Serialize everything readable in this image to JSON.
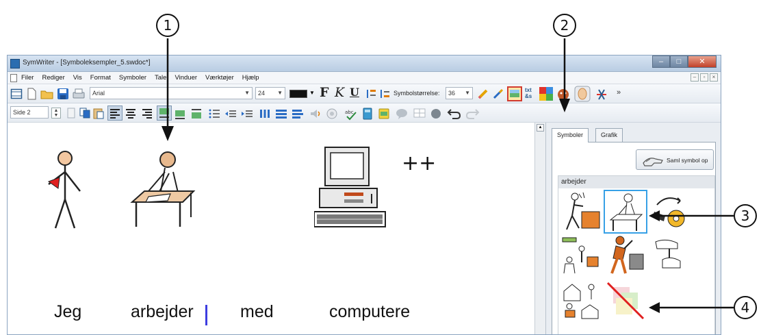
{
  "callouts": [
    "1",
    "2",
    "3",
    "4"
  ],
  "window": {
    "title": "SymWriter - [Symboleksempler_5.swdoc*]",
    "controls": [
      "minimize-icon",
      "maximize-icon",
      "close-icon"
    ]
  },
  "menu": {
    "items": [
      "Filer",
      "Rediger",
      "Vis",
      "Format",
      "Symboler",
      "Tale",
      "Vinduer",
      "Værktøjer",
      "Hjælp"
    ]
  },
  "toolbar1": {
    "font": "Arial",
    "font_size": "24",
    "bold": "F",
    "italic": "K",
    "underline": "U",
    "symbol_size_label": "Symbolstørrelse:",
    "symbol_size": "36",
    "overflow": "»",
    "text_color": "#111111"
  },
  "toolbar2": {
    "page": "Side 2"
  },
  "document": {
    "words": [
      "Jeg",
      "arbejder",
      "med",
      "computere"
    ],
    "plural_mark": "++",
    "cursor_color": "#3d3de0"
  },
  "panel": {
    "tabs": [
      "Symboler",
      "Grafik"
    ],
    "active_tab": "Symboler",
    "pickup_button": "Saml symbol op",
    "search_word": "arbejder",
    "symbols": [
      "person-with-box-symbol",
      "person-at-desk-symbol",
      "gear-symbol",
      "group-working-symbol",
      "person-hammering-symbol",
      "hand-pull-symbol",
      "workplace-scene-symbol",
      "no-symbol"
    ],
    "selected_symbol": "person-at-desk-symbol",
    "selection_color": "#36a0e6"
  }
}
